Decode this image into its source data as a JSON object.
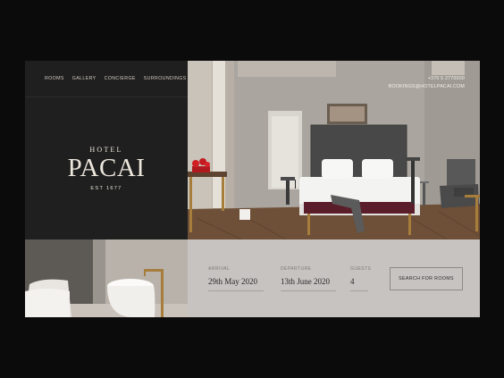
{
  "nav": {
    "items": [
      {
        "label": "ROOMS"
      },
      {
        "label": "GALLERY"
      },
      {
        "label": "CONCIERGE"
      },
      {
        "label": "SURROUNDINGS"
      }
    ]
  },
  "logo": {
    "hotel": "HOTEL",
    "name": "PACAI",
    "est": "EST 1677"
  },
  "contact": {
    "phone": "+370 5 2770000",
    "email": "BOOKINGS@HOTELPACAI.COM"
  },
  "booking": {
    "arrival": {
      "label": "ARRIVAL",
      "value": "29th May 2020"
    },
    "departure": {
      "label": "DEPARTURE",
      "value": "13th June 2020"
    },
    "guests": {
      "label": "GUESTS",
      "value": "4"
    },
    "search_label": "SEARCH FOR ROOMS"
  },
  "colors": {
    "page_background": "#0b0b0b",
    "left_panel": "#1f1f1f",
    "booking_bar": "#c7c3c1",
    "logo_text": "#ece6dc",
    "headboard": "#484848",
    "bench_upholstery": "#5a1e2a",
    "brass_accent": "#a77d3c"
  },
  "images": {
    "hero": "hotel-bedroom-photo",
    "bath": "freestanding-bathtub-photo"
  }
}
